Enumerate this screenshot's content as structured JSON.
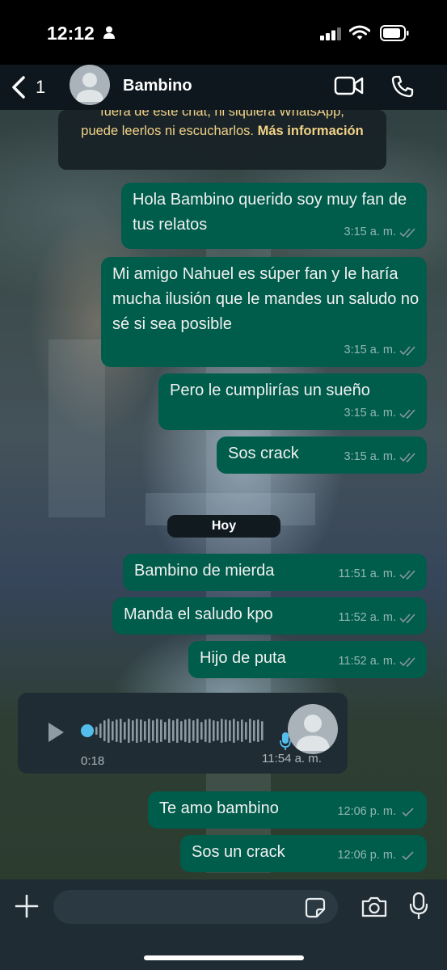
{
  "status_bar": {
    "time": "12:12"
  },
  "header": {
    "back_count": "1",
    "contact_name": "Bambino"
  },
  "notice": {
    "line_partial": "fuera de este chat, ni siquiera WhatsApp,",
    "line": "puede leerlos ni escucharlos.",
    "link": "Más información"
  },
  "messages": [
    {
      "text": "Hola Bambino querido soy muy fan de tus relatos",
      "time": "3:15 a. m."
    },
    {
      "text": "Mi amigo Nahuel es súper fan y le haría mucha ilusión que le mandes un saludo no sé si sea posible",
      "time": "3:15 a. m."
    },
    {
      "text": "Pero le cumplirías un sueño",
      "time": "3:15 a. m."
    },
    {
      "text": "Sos crack",
      "time": "3:15 a. m."
    },
    {
      "text": "Bambino de mierda",
      "time": "11:51 a. m."
    },
    {
      "text": "Manda el saludo kpo",
      "time": "11:52 a. m."
    },
    {
      "text": "Hijo de puta",
      "time": "11:52 a. m."
    },
    {
      "text": "Te amo bambino",
      "time": "12:06 p. m."
    },
    {
      "text": "Sos un crack",
      "time": "12:06 p. m."
    }
  ],
  "date_divider": "Hoy",
  "voice_message": {
    "duration": "0:18",
    "time": "11:54 a. m.",
    "progress": 0
  },
  "input": {
    "placeholder": ""
  },
  "colors": {
    "outgoing_bubble": "#005c4b",
    "incoming_bubble": "#1f2c33",
    "notice_text": "#f2d387",
    "read_ticks": "#8696a0",
    "voice_accent": "#53bdeb"
  },
  "icons": [
    "person-icon",
    "signal-icon",
    "wifi-icon",
    "battery-icon",
    "back-chevron-icon",
    "avatar-icon",
    "video-call-icon",
    "phone-icon",
    "double-check-icon",
    "single-check-icon",
    "play-icon",
    "microphone-icon",
    "plus-icon",
    "sticker-icon",
    "camera-icon"
  ]
}
